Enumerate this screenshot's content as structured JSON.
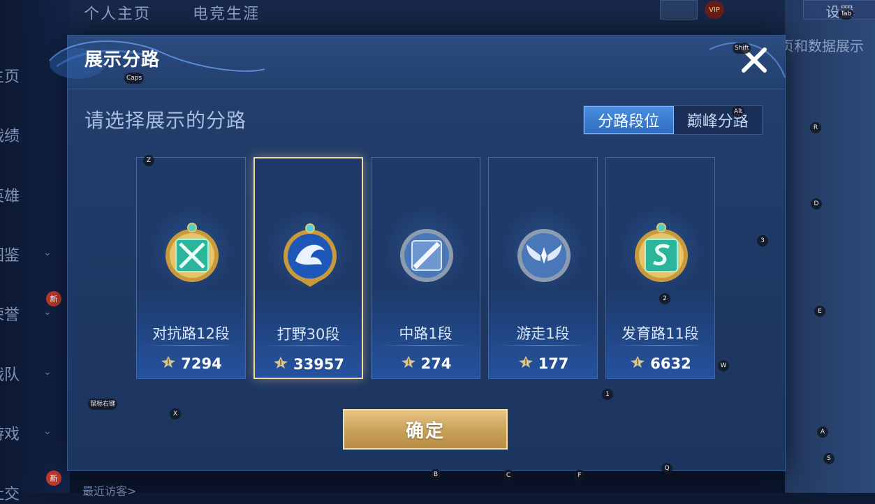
{
  "background": {
    "top_tabs": [
      "个人主页",
      "电竞生涯"
    ],
    "side_items": [
      {
        "label": "主页",
        "chevron": false
      },
      {
        "label": "战绩",
        "chevron": false
      },
      {
        "label": "英雄",
        "chevron": false
      },
      {
        "label": "图鉴",
        "chevron": true
      },
      {
        "label": "荣誉",
        "chevron": true,
        "badge": "新"
      },
      {
        "label": "战队",
        "chevron": true
      },
      {
        "label": "游戏",
        "chevron": true
      },
      {
        "label": "社交",
        "chevron": false,
        "badge": "新"
      }
    ],
    "vip_label": "VIP",
    "settings_label": "设置",
    "caption": "主页和数据展示",
    "recent_visitors": "最近访客>"
  },
  "dialog": {
    "title": "展示分路",
    "prompt": "请选择展示的分路",
    "tabs": [
      {
        "label": "分路段位",
        "active": true
      },
      {
        "label": "巅峰分路",
        "active": false
      }
    ],
    "confirm_label": "确定"
  },
  "lanes": [
    {
      "name": "对抗路12段",
      "score": "7294",
      "selected": false,
      "icon": "clash-lane-icon"
    },
    {
      "name": "打野30段",
      "score": "33957",
      "selected": true,
      "icon": "jungle-dragon-icon"
    },
    {
      "name": "中路1段",
      "score": "274",
      "selected": false,
      "icon": "mid-lane-icon"
    },
    {
      "name": "游走1段",
      "score": "177",
      "selected": false,
      "icon": "roam-wings-icon"
    },
    {
      "name": "发育路11段",
      "score": "6632",
      "selected": false,
      "icon": "farm-lane-icon"
    }
  ],
  "key_hints": [
    {
      "key": "Tab"
    },
    {
      "key": "Shift"
    },
    {
      "key": "Caps"
    },
    {
      "key": "Alt"
    },
    {
      "key": "R"
    },
    {
      "key": "Z"
    },
    {
      "key": "D"
    },
    {
      "key": "3"
    },
    {
      "key": "2"
    },
    {
      "key": "E"
    },
    {
      "key": "W"
    },
    {
      "key": "1"
    },
    {
      "key": "鼠标右键"
    },
    {
      "key": "X"
    },
    {
      "key": "A"
    },
    {
      "key": "S"
    },
    {
      "key": "Q"
    },
    {
      "key": "B"
    },
    {
      "key": "C"
    },
    {
      "key": "F"
    }
  ],
  "colors": {
    "dialog_bg": "#1f3a66",
    "accent_blue": "#3a7fd6",
    "selected_border": "#f2d8a3",
    "confirm_gold": "#caa25a"
  }
}
